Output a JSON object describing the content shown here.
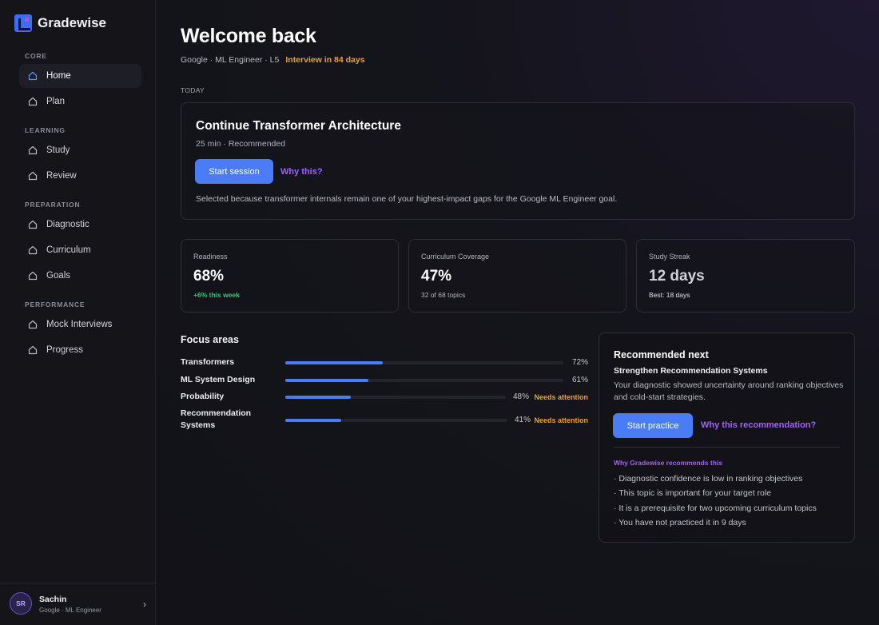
{
  "app": {
    "name": "Gradewise"
  },
  "sidebar": {
    "sections": [
      {
        "title": "CORE",
        "items": [
          {
            "label": "Home",
            "active": true
          },
          {
            "label": "Plan"
          }
        ]
      },
      {
        "title": "LEARNING",
        "items": [
          {
            "label": "Study"
          },
          {
            "label": "Review"
          }
        ]
      },
      {
        "title": "PREPARATION",
        "items": [
          {
            "label": "Diagnostic"
          },
          {
            "label": "Curriculum"
          },
          {
            "label": "Goals"
          }
        ]
      },
      {
        "title": "PERFORMANCE",
        "items": [
          {
            "label": "Mock Interviews"
          },
          {
            "label": "Progress"
          }
        ]
      }
    ],
    "user": {
      "initials": "SR",
      "name": "Sachin",
      "role": "Google · ML Engineer"
    }
  },
  "header": {
    "title": "Welcome back",
    "subtitle": "Google · ML Engineer · L5",
    "interview_badge": "Interview in 84 days"
  },
  "today": {
    "label": "TODAY",
    "title": "Continue Transformer Architecture",
    "meta": "25 min · Recommended",
    "start_label": "Start session",
    "why_label": "Why this?",
    "description": "Selected because transformer internals remain one of your highest-impact gaps for the Google ML Engineer goal."
  },
  "stats": [
    {
      "label": "Readiness",
      "value": "68%",
      "sub": "+6% this week",
      "sub_positive": true
    },
    {
      "label": "Curriculum Coverage",
      "value": "47%",
      "sub": "32 of 68 topics"
    },
    {
      "label": "Study Streak",
      "value": "12 days",
      "sub": "Best: 18 days"
    }
  ],
  "focus": {
    "title": "Focus areas",
    "items": [
      {
        "name": "Transformers",
        "percent": 72,
        "pct_label": "72%",
        "warning": ""
      },
      {
        "name": "ML System Design",
        "percent": 61,
        "pct_label": "61%",
        "warning": ""
      },
      {
        "name": "Probability",
        "percent": 48,
        "pct_label": "48%",
        "warning": "Needs attention"
      },
      {
        "name": "Recommendation Systems",
        "percent": 41,
        "pct_label": "41%",
        "warning": "Needs attention"
      }
    ]
  },
  "recommended": {
    "title": "Recommended next",
    "topic": "Strengthen Recommendation Systems",
    "description": "Your diagnostic showed uncertainty around ranking objectives and cold-start strategies.",
    "start_label": "Start practice",
    "why_label": "Why this recommendation?",
    "why_heading": "Why Gradewise recommends this",
    "reasons": [
      "· Diagnostic confidence is low in ranking objectives",
      "· This topic is important for your target role",
      "· It is a prerequisite for two upcoming curriculum topics",
      "· You have not practiced it in 9 days"
    ]
  },
  "colors": {
    "accent": "#4a7cf5",
    "purple": "#a463f2",
    "warning": "#f0a12c",
    "positive": "#34c474"
  }
}
